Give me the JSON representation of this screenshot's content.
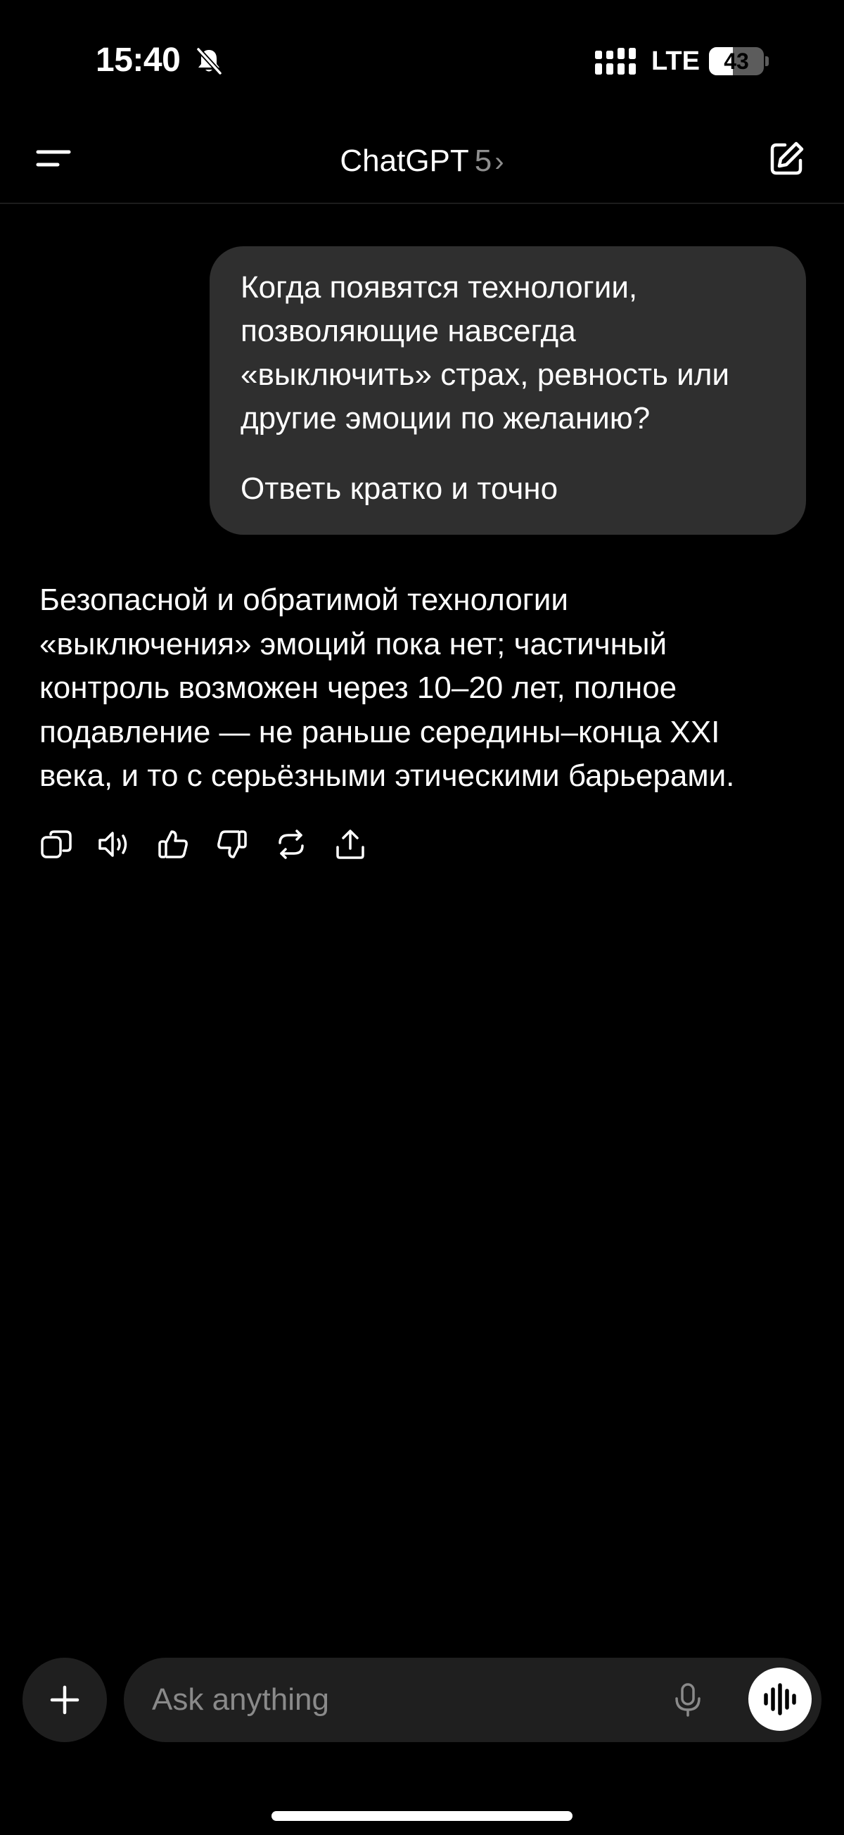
{
  "status_bar": {
    "time": "15:40",
    "network": "LTE",
    "battery_level": "43",
    "battery_fraction": 0.43
  },
  "header": {
    "app_name": "ChatGPT",
    "model_version": "5",
    "chevron": "›"
  },
  "icons": {
    "menu": "menu-icon",
    "compose": "new-chat-icon",
    "copy": "copy-icon",
    "read_aloud": "speaker-icon",
    "thumbs_up": "thumbs-up-icon",
    "thumbs_down": "thumbs-down-icon",
    "regenerate": "regenerate-icon",
    "share": "share-icon",
    "plus": "plus-icon",
    "mic": "microphone-icon",
    "voice": "voice-mode-icon",
    "bell_muted": "bell-slash-icon",
    "signal": "signal-icon"
  },
  "conversation": {
    "user_message": {
      "lines": [
        "Когда появятся технологии,",
        "позволяющие навсегда",
        "«выключить» страх, ревность или",
        "другие эмоции по желанию?"
      ],
      "followup": "Ответь кратко и точно"
    },
    "assistant_message": {
      "lines": [
        "Безопасной и обратимой технологии",
        "«выключения» эмоций пока нет; частичный",
        "контроль возможен через 10–20 лет, полное",
        "подавление — не раньше середины–конца XXI",
        "века, и то с серьёзными этическими барьерами."
      ]
    }
  },
  "composer": {
    "placeholder": "Ask anything"
  },
  "colors": {
    "background": "#000000",
    "bubble": "#2f2f2f",
    "composer": "#1f1f1f",
    "muted_text": "#8e8e8e"
  }
}
